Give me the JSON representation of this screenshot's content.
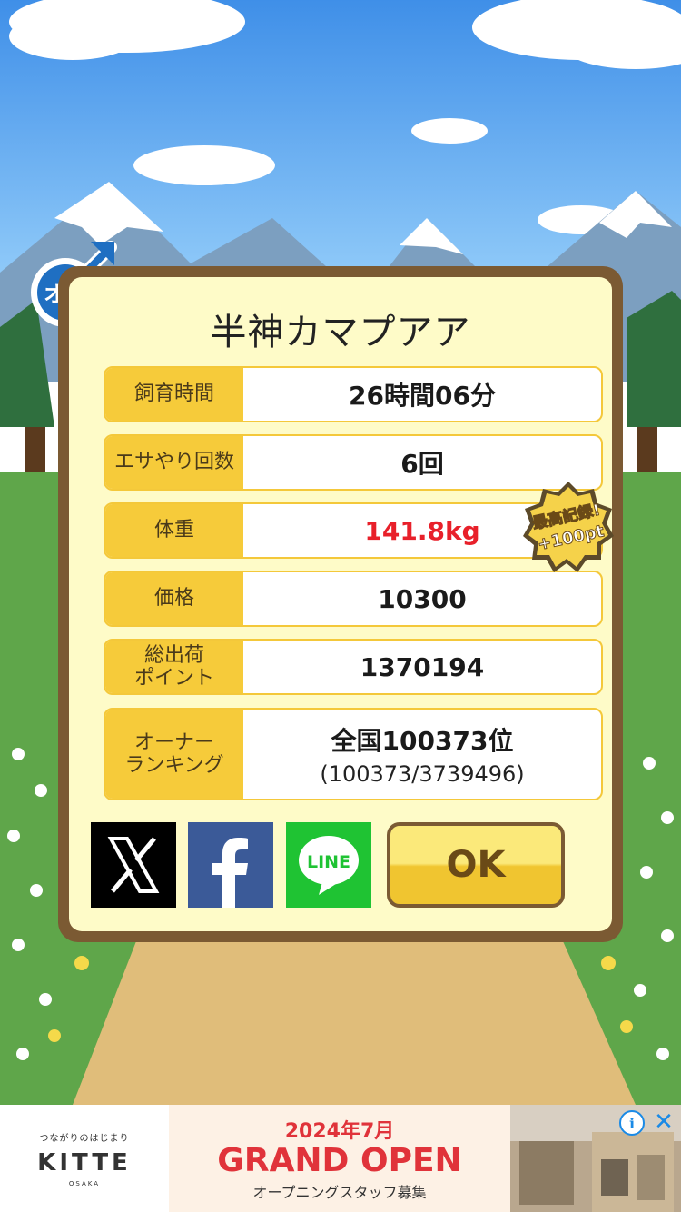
{
  "pig": {
    "name": "半神カマプアア",
    "gender_label": "オス"
  },
  "stats": [
    {
      "label": "飼育時間",
      "value": "26時間06分"
    },
    {
      "label": "エサやり回数",
      "value": "6回"
    },
    {
      "label": "体重",
      "value": "141.8kg"
    },
    {
      "label": "価格",
      "value": "10300"
    },
    {
      "label": "総出荷\nポイント",
      "value": "1370194"
    },
    {
      "label": "オーナー\nランキング",
      "value": "全国100373位",
      "sub": "(100373/3739496)"
    }
  ],
  "record_badge": {
    "line1": "最高記録!",
    "line2": "+100pt"
  },
  "share": {
    "x_label": "X",
    "facebook_label": "f",
    "line_label": "LINE"
  },
  "ok_label": "OK",
  "ad": {
    "tagline": "つながりのはじまり",
    "brand": "KITTE",
    "city": "OSAKA",
    "date": "2024年7月",
    "headline": "GRAND OPEN",
    "subline": "オープニングスタッフ募集",
    "close_symbol": "✕",
    "info_symbol": "i"
  },
  "colors": {
    "accent_yellow": "#f6cb3a",
    "frame_brown": "#7b5a33",
    "record_red": "#e8202a"
  }
}
